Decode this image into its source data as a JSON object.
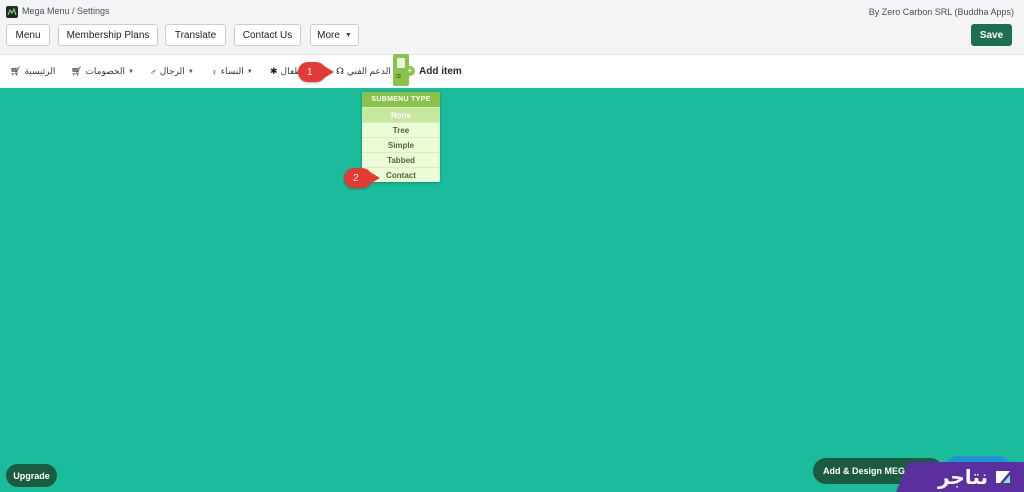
{
  "header": {
    "breadcrumb": "Mega Menu / Settings",
    "byline": "By Zero Carbon SRL (Buddha Apps)",
    "nav_buttons": [
      {
        "label": "Menu"
      },
      {
        "label": "Membership Plans"
      },
      {
        "label": "Translate"
      },
      {
        "label": "Contact Us"
      },
      {
        "label": "More"
      }
    ],
    "save_label": "Save"
  },
  "menu_items": [
    {
      "label": "الرئيسية",
      "icon": "cart-icon"
    },
    {
      "label": "الخصومات",
      "icon": "cart-icon"
    },
    {
      "label": "الرجال",
      "icon": "man-icon"
    },
    {
      "label": "النساء",
      "icon": "woman-icon"
    },
    {
      "label": "اطفال",
      "icon": "child-icon"
    },
    {
      "label": "الدعم الفني",
      "icon": "headset-icon"
    }
  ],
  "add_item_label": "Add item",
  "submenu": {
    "heading": "SUBMENU TYPE",
    "options": [
      "None",
      "Tree",
      "Simple",
      "Tabbed",
      "Contact"
    ],
    "selected": "None"
  },
  "callouts": [
    "1",
    "2"
  ],
  "footer": {
    "upgrade_label": "Upgrade",
    "add_design_label": "Add & Design MEGA"
  },
  "brand": {
    "text": "نتاجر"
  },
  "colors": {
    "canvas": "#1abc9c",
    "primary_button": "#1e6f4f",
    "submenu_accent": "#8bc34a",
    "callout": "#e53935",
    "brand": "#5c2f9e"
  }
}
